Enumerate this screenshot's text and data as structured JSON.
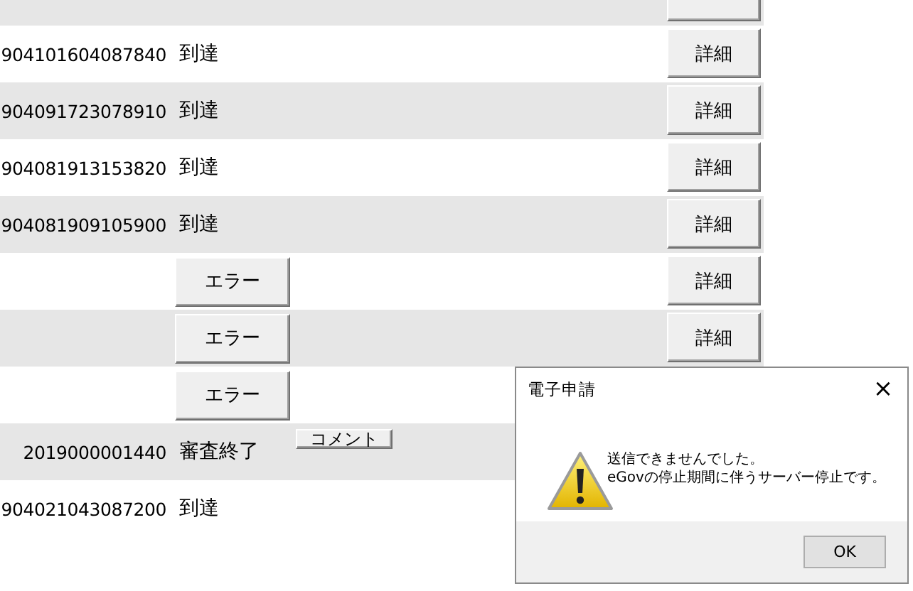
{
  "rows": [
    {
      "kind": "cut"
    },
    {
      "kind": "result",
      "id": "904101604087840",
      "status": "到達",
      "detail_button": "詳細"
    },
    {
      "kind": "result",
      "id": "904091723078910",
      "status": "到達",
      "detail_button": "詳細"
    },
    {
      "kind": "result",
      "id": "904081913153820",
      "status": "到達",
      "detail_button": "詳細"
    },
    {
      "kind": "result",
      "id": "904081909105900",
      "status": "到達",
      "detail_button": "詳細"
    },
    {
      "kind": "error",
      "error_button": "エラー",
      "detail_button": "詳細"
    },
    {
      "kind": "error",
      "error_button": "エラー",
      "detail_button": "詳細"
    },
    {
      "kind": "error",
      "error_button": "エラー"
    },
    {
      "kind": "comment",
      "id": "2019000001440",
      "status": "審査終了",
      "comment_button": "コメント"
    },
    {
      "kind": "result",
      "id": "904021043087200",
      "status": "到達"
    }
  ],
  "dialog": {
    "title": "電子申請",
    "close": "×",
    "message_lines": [
      "送信できませんでした。",
      "eGovの停止期間に伴うサーバー停止です。"
    ],
    "ok_button": "OK"
  }
}
